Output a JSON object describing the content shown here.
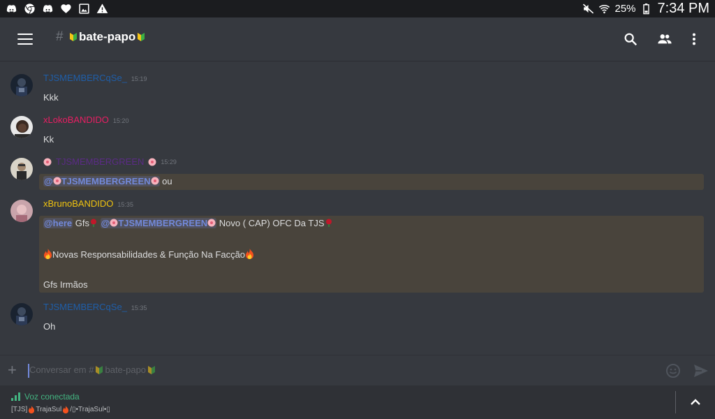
{
  "status_bar": {
    "left_icons": [
      "discord-icon",
      "chrome-icon",
      "discord-icon",
      "heart-icon",
      "image-icon",
      "warning-icon"
    ],
    "battery_percent": "25%",
    "time": "7:34 PM"
  },
  "header": {
    "hash": "#",
    "channel_name": "bate-papo"
  },
  "messages": [
    {
      "username": "TJSMEMBERCqSe_",
      "time": "15:19",
      "color": "#1f5ea8",
      "lines": [
        "Kkk"
      ],
      "highlighted": false
    },
    {
      "username": "xLokoBANDIDO",
      "time": "15:20",
      "color": "#e91e63",
      "lines": [
        "Kk"
      ],
      "highlighted": false
    },
    {
      "username": "TJSMEMBERGREEN",
      "time": "15:29",
      "color": "#5b2b86",
      "lines": [],
      "highlighted": true
    },
    {
      "username": "xBrunoBANDIDO",
      "time": "15:35",
      "color": "#f1c40f",
      "lines": [],
      "highlighted": true
    },
    {
      "username": "TJSMEMBERCqSe_",
      "time": "15:35",
      "color": "#1f5ea8",
      "lines": [
        "Oh"
      ],
      "highlighted": false
    }
  ],
  "msg3": {
    "mention_at": "@",
    "mention_name": "TJSMEMBERGREEN",
    "text": "ou"
  },
  "msg4": {
    "here": "@here",
    "gfs": "Gfs",
    "mention_at": "@",
    "mention_name": "TJSMEMBERGREEN",
    "announce": "Novo ( CAP) OFC Da TJS",
    "line2": "Novas Responsabilidades & Função Na Facção",
    "line3": "Gfs Irmãos"
  },
  "input": {
    "placeholder_prefix": "Conversar em #",
    "placeholder_channel": "bate-papo"
  },
  "voice": {
    "status": "Voz conectada",
    "channel_a": "[TJS]",
    "channel_b": "TrajaSul",
    "channel_c": "/▯•TrajaSul•▯"
  },
  "colors": {
    "background": "#36393f",
    "statusbar": "#1b1c1f",
    "highlight": "#49443c",
    "mention": "#7289da",
    "voice_green": "#43b581"
  }
}
